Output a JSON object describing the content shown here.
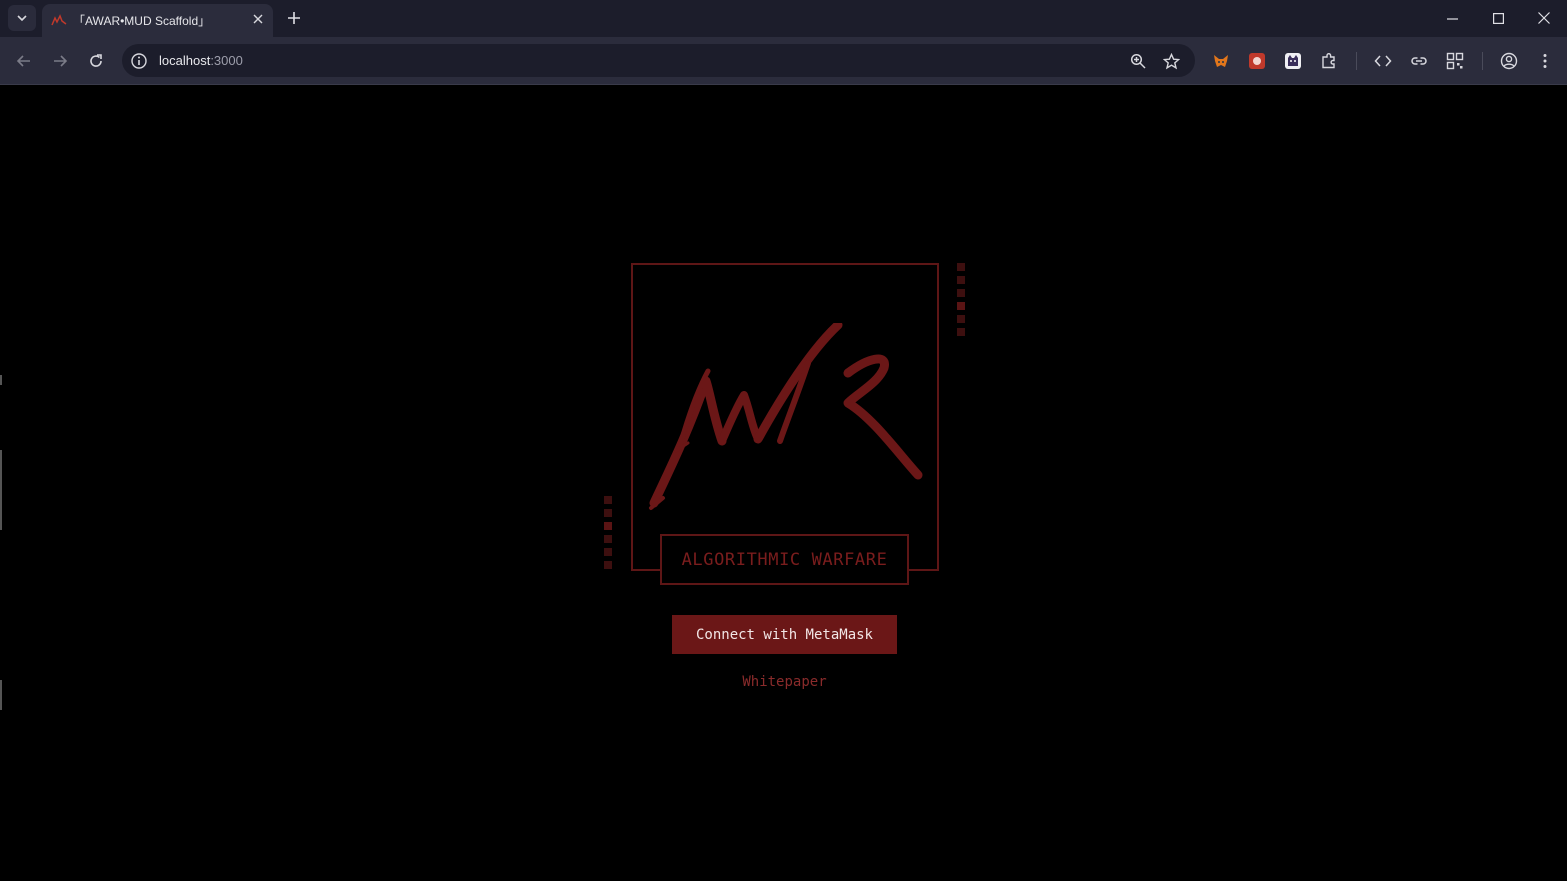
{
  "browser": {
    "tab": {
      "title": "「AWAR•MUD Scaffold」"
    },
    "omnibox": {
      "host": "localhost",
      "port": ":3000"
    },
    "colors": {
      "chrome": "#1c1d2b",
      "toolbar": "#2b2c3c",
      "accent": "#6b1717"
    }
  },
  "page": {
    "brand_label": "ALGORITHMIC WARFARE",
    "connect_button": "Connect with MetaMask",
    "whitepaper_link": "Whitepaper",
    "colors": {
      "background": "#000000",
      "primary": "#6b1717",
      "frame": "#5e1616",
      "text": "#7a1d1d"
    }
  }
}
